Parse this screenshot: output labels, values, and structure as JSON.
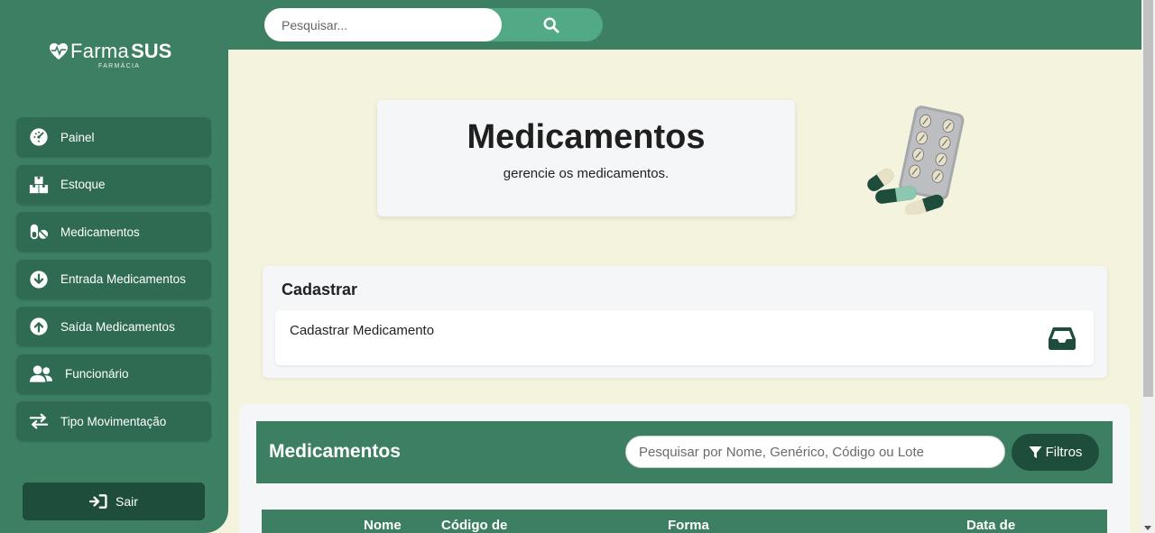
{
  "brand": {
    "name_light": "Farma",
    "name_bold": "SUS",
    "subtitle": "FARMÁCIA"
  },
  "sidebar": {
    "items": [
      {
        "label": "Painel",
        "icon": "dashboard-icon"
      },
      {
        "label": "Estoque",
        "icon": "boxes-icon"
      },
      {
        "label": "Medicamentos",
        "icon": "pills-icon"
      },
      {
        "label": "Entrada Medicamentos",
        "icon": "arrow-down-circle-icon"
      },
      {
        "label": "Saída Medicamentos",
        "icon": "arrow-up-circle-icon"
      },
      {
        "label": "Funcionário",
        "icon": "users-icon"
      },
      {
        "label": "Tipo Movimentação",
        "icon": "swap-arrows-icon"
      }
    ],
    "logout_label": "Sair"
  },
  "topbar": {
    "search_placeholder": "Pesquisar..."
  },
  "hero": {
    "title": "Medicamentos",
    "subtitle": "gerencie os medicamentos."
  },
  "cadastrar": {
    "title": "Cadastrar",
    "card_label": "Cadastrar Medicamento"
  },
  "list": {
    "title": "Medicamentos",
    "search_placeholder": "Pesquisar por Nome, Genérico, Código ou Lote",
    "filter_label": "Filtros",
    "columns": [
      "Nome",
      "Código de",
      "Forma",
      "Data de"
    ]
  },
  "colors": {
    "primary": "#3d7f63",
    "dark": "#1e4d3b",
    "accent": "#52a985",
    "background": "#f4f3dd"
  }
}
